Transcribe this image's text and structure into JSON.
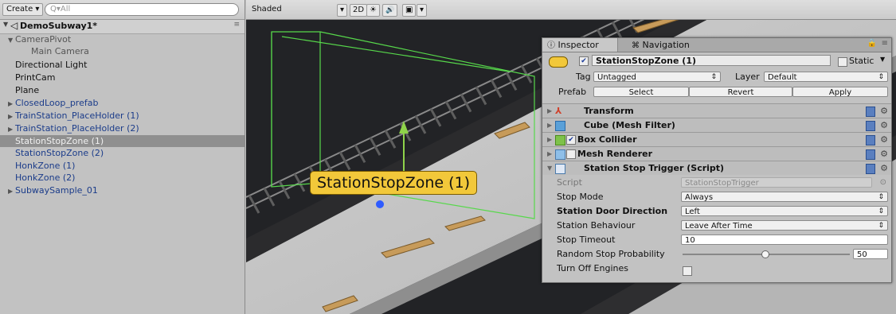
{
  "hierarchy": {
    "create_label": "Create ▾",
    "search_placeholder": "Q▾All",
    "scene_name": "DemoSubway1*",
    "items": [
      {
        "label": "CameraPivot",
        "arrow": "▼"
      },
      {
        "label": "Main Camera"
      },
      {
        "label": "Directional Light"
      },
      {
        "label": "PrintCam"
      },
      {
        "label": "Plane"
      },
      {
        "label": "ClosedLoop_prefab",
        "arrow": "▶"
      },
      {
        "label": "TrainStation_PlaceHolder (1)",
        "arrow": "▶"
      },
      {
        "label": "TrainStation_PlaceHolder (2)",
        "arrow": "▶"
      },
      {
        "label": "StationStopZone (1)"
      },
      {
        "label": "StationStopZone (2)"
      },
      {
        "label": "HonkZone (1)"
      },
      {
        "label": "HonkZone (2)"
      },
      {
        "label": "SubwaySample_01",
        "arrow": "▶"
      }
    ]
  },
  "scene": {
    "shading_mode": "Shaded",
    "mode_2d": "2D",
    "sun_icon": "☀",
    "audio_icon": "🔊",
    "image_icon": "▣",
    "dropdown_arrow": "▾",
    "object_label": "StationStopZone (1)"
  },
  "inspector": {
    "tab_inspector": "Inspector",
    "tab_navigation": "Navigation",
    "object_name": "StationStopZone (1)",
    "static_label": "Static",
    "tag_label": "Tag",
    "tag_value": "Untagged",
    "layer_label": "Layer",
    "layer_value": "Default",
    "prefab_label": "Prefab",
    "prefab_select": "Select",
    "prefab_revert": "Revert",
    "prefab_apply": "Apply",
    "components": {
      "transform": "Transform",
      "mesh_filter": "Cube (Mesh Filter)",
      "box_collider": "Box Collider",
      "mesh_renderer": "Mesh Renderer",
      "script_component": "Station Stop Trigger (Script)"
    },
    "script_fields": {
      "script_label": "Script",
      "script_value": "StationStopTrigger",
      "stop_mode_label": "Stop Mode",
      "stop_mode_value": "Always",
      "door_direction_label": "Station Door Direction",
      "door_direction_value": "Left",
      "behaviour_label": "Station Behaviour",
      "behaviour_value": "Leave After Time",
      "stop_timeout_label": "Stop Timeout",
      "stop_timeout_value": "10",
      "random_prob_label": "Random Stop Probability",
      "random_prob_value": "50",
      "turn_off_label": "Turn Off Engines"
    }
  },
  "colors": {
    "selection_bg": "#8f8f8f",
    "prefab_text": "#1b3c8a",
    "label_bg": "#f2c83a"
  }
}
